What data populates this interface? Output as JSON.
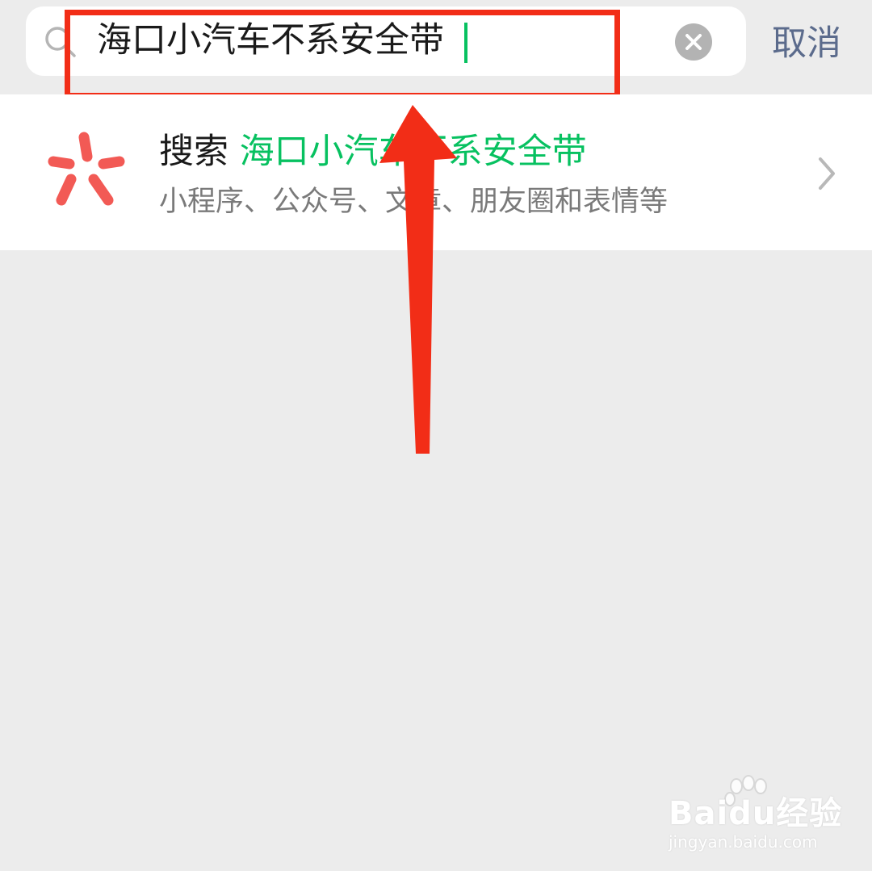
{
  "search": {
    "query": "海口小汽车不系安全带",
    "cancel_label": "取消"
  },
  "result": {
    "prefix": "搜索",
    "keyword": "海口小汽车不系安全带",
    "subtitle": "小程序、公众号、文章、朋友圈和表情等"
  },
  "watermark": {
    "brand": "Baidu经验",
    "url": "jingyan.baidu.com"
  },
  "icons": {
    "search": "search-icon",
    "clear": "clear-icon",
    "sou": "sou-yi-sou-icon",
    "chevron": "chevron-right-icon",
    "arrow": "annotation-arrow"
  },
  "colors": {
    "accent": "#07c160",
    "annotation": "#f22d17",
    "link": "#5b6b8c",
    "sou_icon": "#f25a55"
  }
}
